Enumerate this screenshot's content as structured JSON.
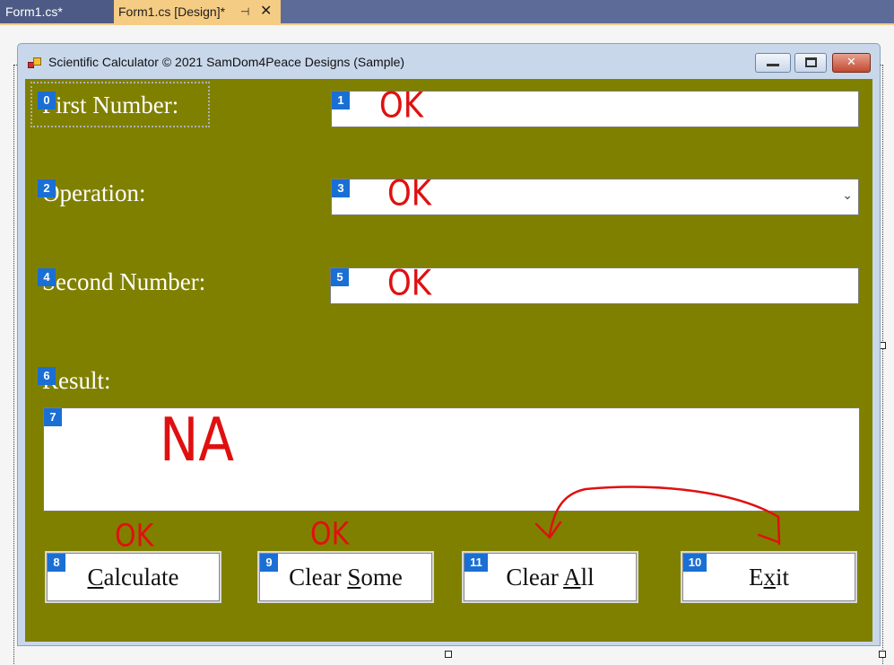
{
  "ide": {
    "tabs": [
      {
        "label": "Form1.cs*"
      },
      {
        "label": "Form1.cs [Design]*"
      }
    ],
    "pin_glyph": "⊣",
    "close_glyph": "✕"
  },
  "form": {
    "title": "Scientific Calculator © 2021 SamDom4Peace Designs (Sample)",
    "labels": {
      "first_number": "First Number:",
      "operation": "Operation:",
      "second_number": "Second Number:",
      "result": "Result:"
    },
    "buttons": {
      "calculate": {
        "pre": "",
        "mnemonic": "C",
        "post": "alculate"
      },
      "clear_some": {
        "pre": "Clear ",
        "mnemonic": "S",
        "post": "ome"
      },
      "clear_all": {
        "pre": "Clear ",
        "mnemonic": "A",
        "post": "ll"
      },
      "exit": {
        "pre": "E",
        "mnemonic": "x",
        "post": "it"
      }
    },
    "combo_arrow": "⌄"
  },
  "indices": [
    "0",
    "1",
    "2",
    "3",
    "4",
    "5",
    "6",
    "7",
    "8",
    "9",
    "10",
    "11"
  ],
  "annotations": {
    "first_input": "OK",
    "operation_input": "OK",
    "second_input": "OK",
    "result_box": "NA",
    "calculate_button": "OK",
    "clear_some_button": "OK"
  },
  "colors": {
    "form_background": "#808000",
    "index_badge": "#1a6fd4",
    "annotation": "#e01010",
    "active_tab": "#f5cc84"
  }
}
